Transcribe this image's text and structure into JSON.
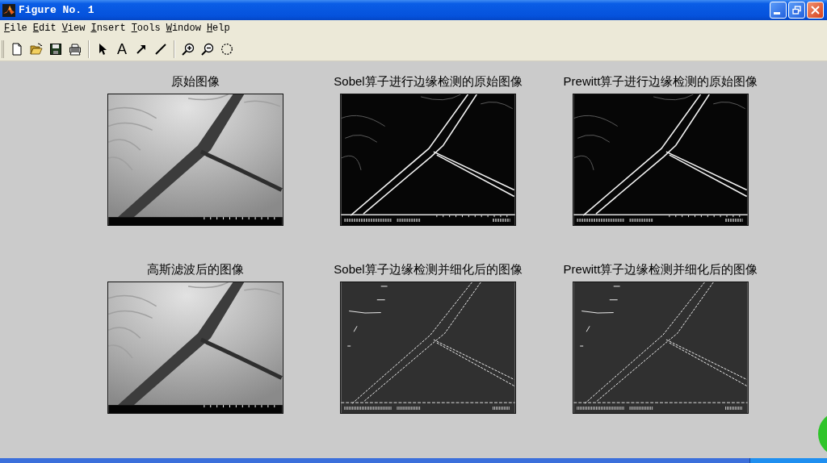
{
  "window": {
    "title": "Figure No. 1"
  },
  "menu": [
    "File",
    "Edit",
    "View",
    "Insert",
    "Tools",
    "Window",
    "Help"
  ],
  "toolbar": {
    "text_tool": "A"
  },
  "panels": [
    {
      "title": "原始图像",
      "kind": "photo"
    },
    {
      "title": "Sobel算子进行边缘检测的原始图像",
      "kind": "edges"
    },
    {
      "title": "Prewitt算子进行边缘检测的原始图像",
      "kind": "edges"
    },
    {
      "title": "高斯滤波后的图像",
      "kind": "photo"
    },
    {
      "title": "Sobel算子边缘检测并细化后的图像",
      "kind": "thinned"
    },
    {
      "title": "Prewitt算子边缘检测并细化后的图像",
      "kind": "thinned"
    }
  ]
}
